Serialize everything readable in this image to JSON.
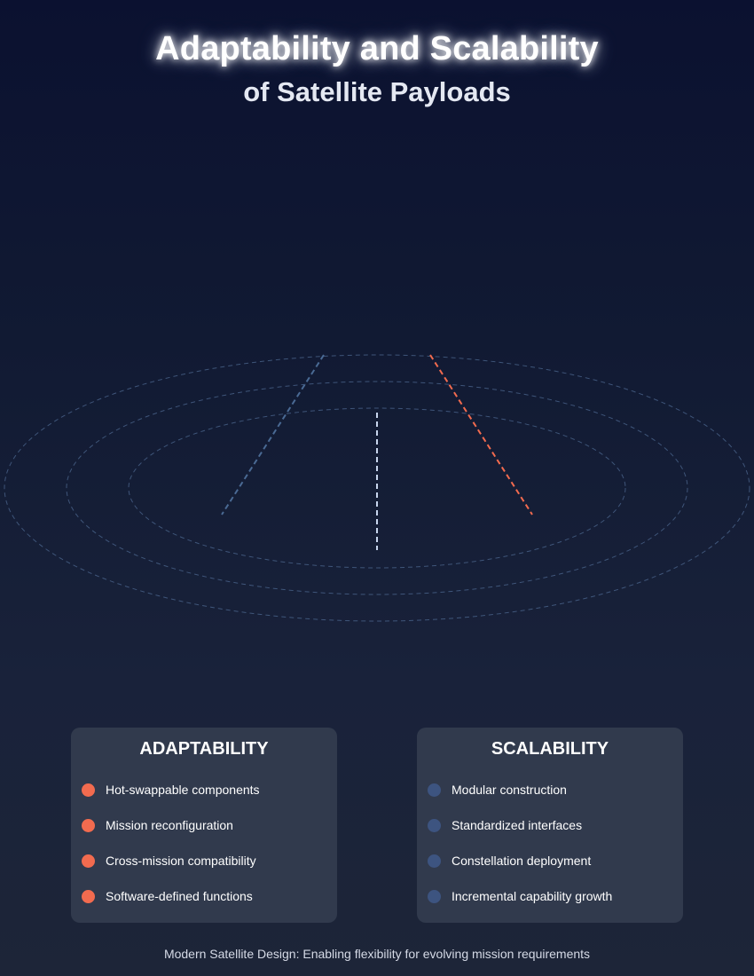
{
  "header": {
    "title": "Adaptability and Scalability",
    "subtitle": "of Satellite Payloads"
  },
  "colors": {
    "adaptability_accent": "#f26b4f",
    "scalability_accent": "#3d5480",
    "orbit_stroke": "#4e6890",
    "center_beam": "#c8d6ee"
  },
  "adaptability": {
    "title": "ADAPTABILITY",
    "items": [
      "Hot-swappable components",
      "Mission reconfiguration",
      "Cross-mission compatibility",
      "Software-defined functions"
    ]
  },
  "scalability": {
    "title": "SCALABILITY",
    "items": [
      "Modular construction",
      "Standardized interfaces",
      "Constellation deployment",
      "Incremental capability growth"
    ]
  },
  "footer": {
    "caption": "Modern Satellite Design: Enabling flexibility for evolving mission requirements"
  }
}
